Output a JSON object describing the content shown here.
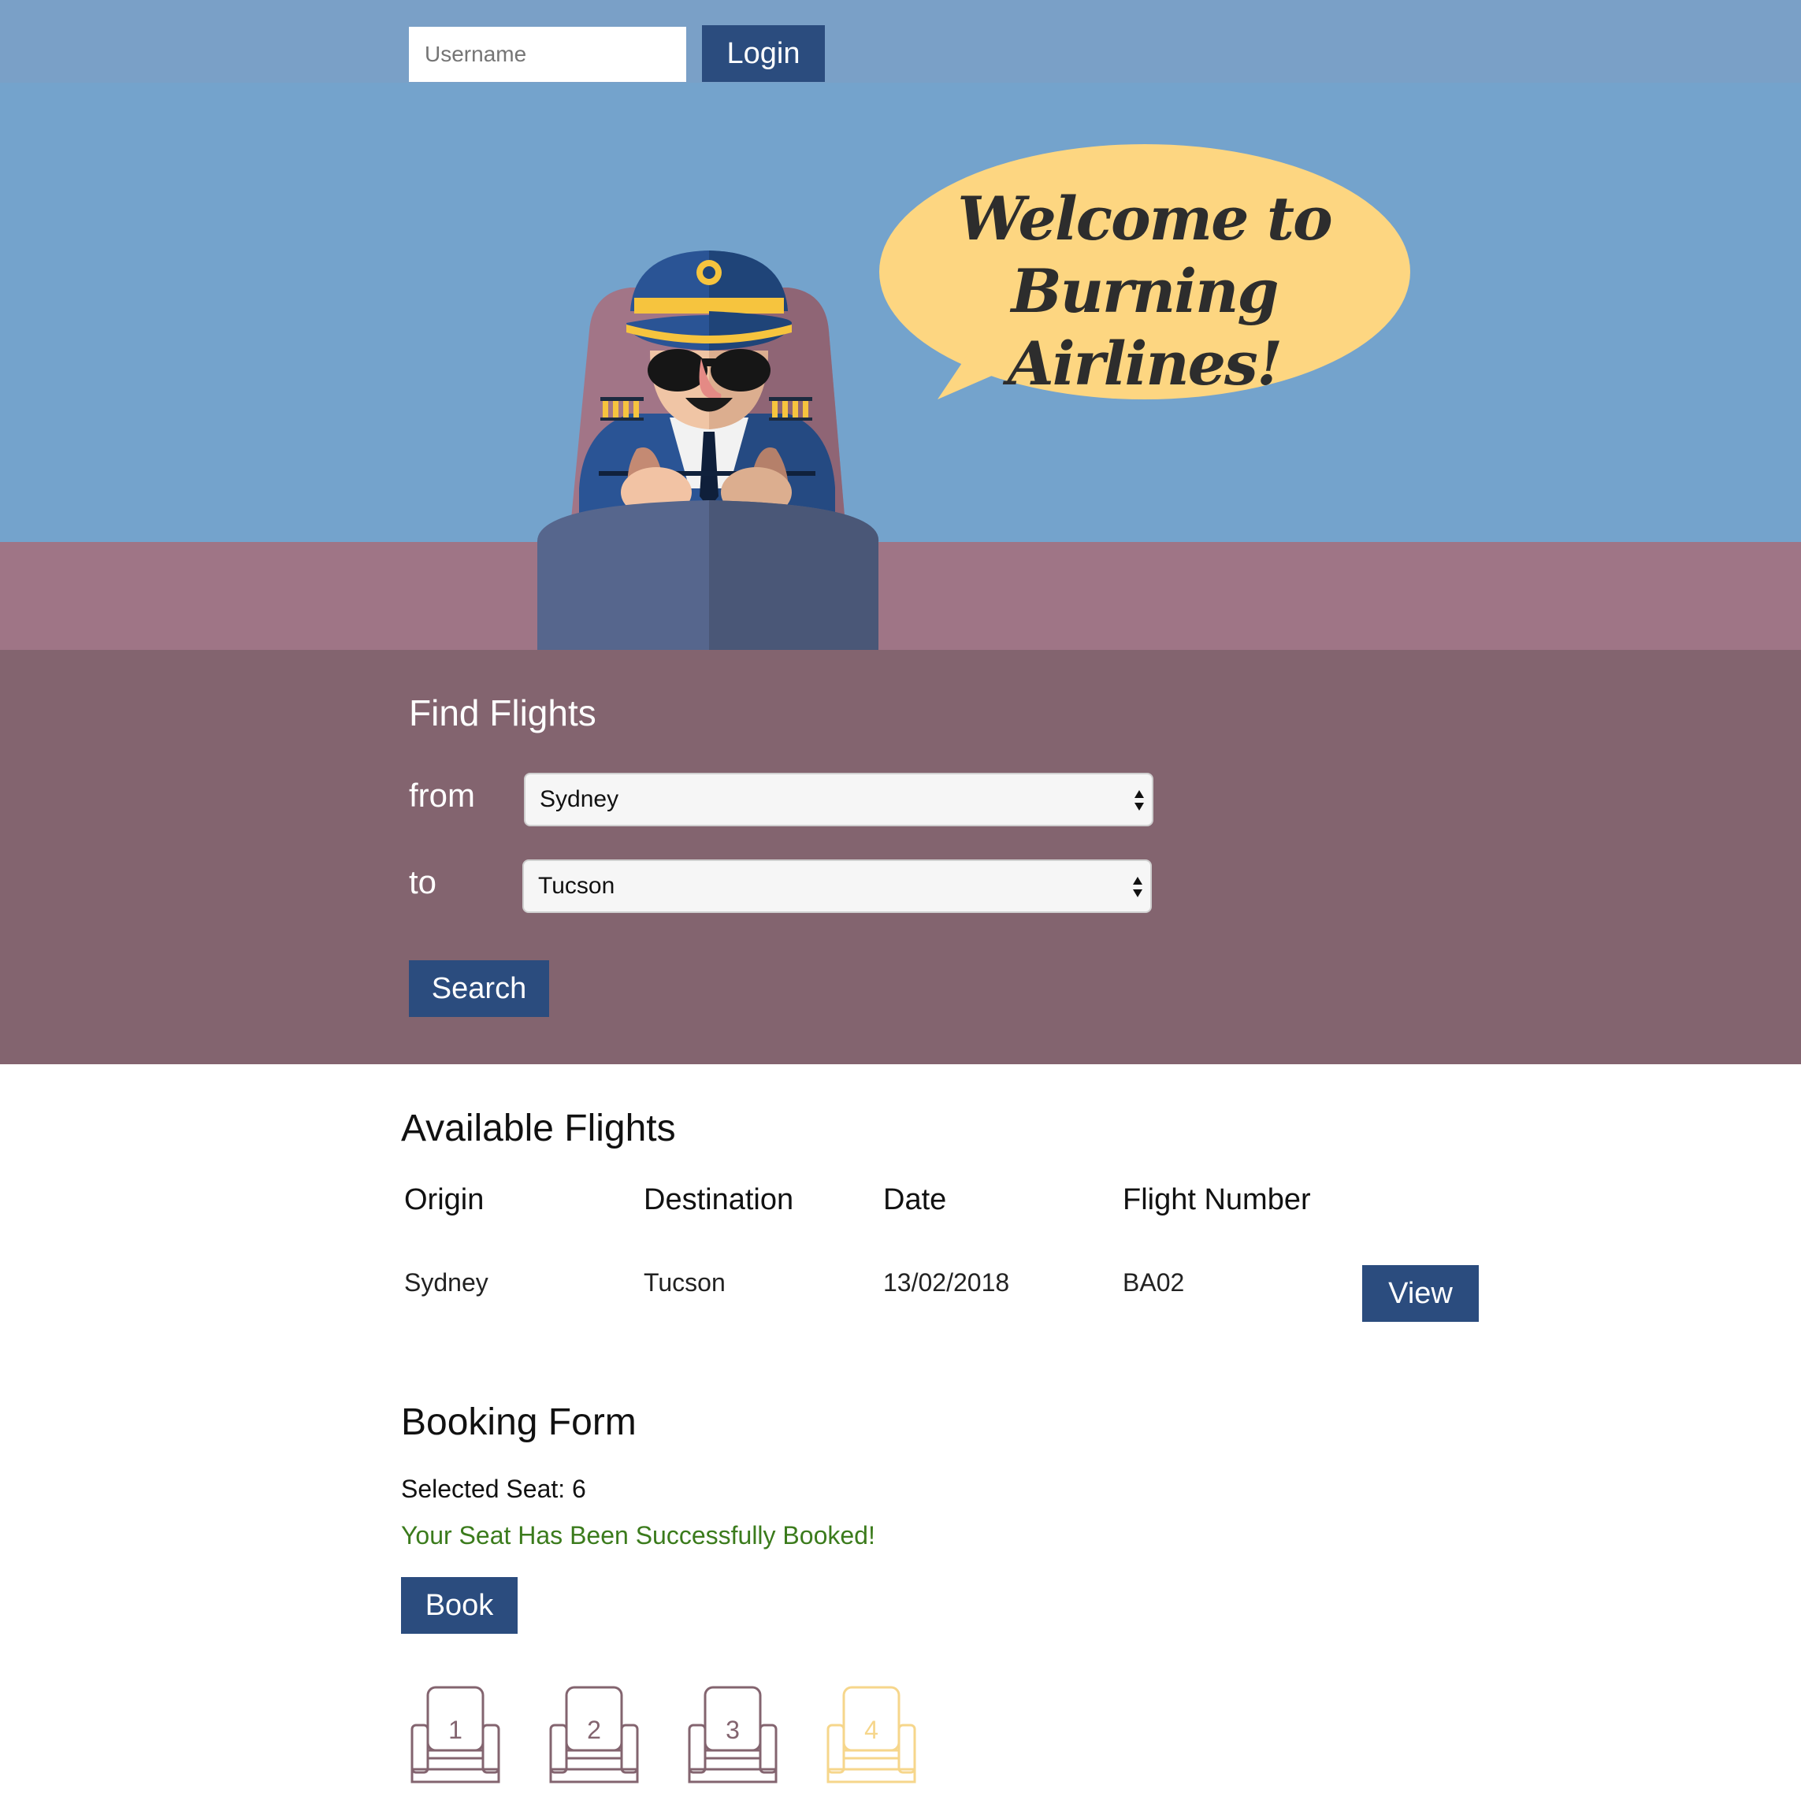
{
  "header": {
    "username_placeholder": "Username",
    "login_label": "Login"
  },
  "hero": {
    "welcome_text": "Welcome to\nBurning Airlines!"
  },
  "search": {
    "title": "Find Flights",
    "from_label": "from",
    "from_value": "Sydney",
    "to_label": "to",
    "to_value": "Tucson",
    "search_label": "Search"
  },
  "flights": {
    "title": "Available Flights",
    "columns": [
      "Origin",
      "Destination",
      "Date",
      "Flight Number"
    ],
    "rows": [
      {
        "origin": "Sydney",
        "destination": "Tucson",
        "date": "13/02/2018",
        "flight_number": "BA02",
        "action_label": "View"
      }
    ]
  },
  "booking": {
    "title": "Booking Form",
    "selected_seat": "Selected Seat: 6",
    "success_message": "Your Seat Has Been Successfully Booked!",
    "book_label": "Book",
    "seats": [
      {
        "number": "1",
        "state": "available"
      },
      {
        "number": "2",
        "state": "available"
      },
      {
        "number": "3",
        "state": "available"
      },
      {
        "number": "4",
        "state": "taken"
      }
    ]
  },
  "colors": {
    "primary_button": "#2b4c7e",
    "header_bg": "#7aa0c7",
    "sky": "#74a3cc",
    "ground": "#9f7586",
    "search_bg": "#83646f",
    "speech_bubble": "#fdd681",
    "success_text": "#3b7b1c",
    "seat_available": "#83646f",
    "seat_taken": "#f6d68b"
  }
}
